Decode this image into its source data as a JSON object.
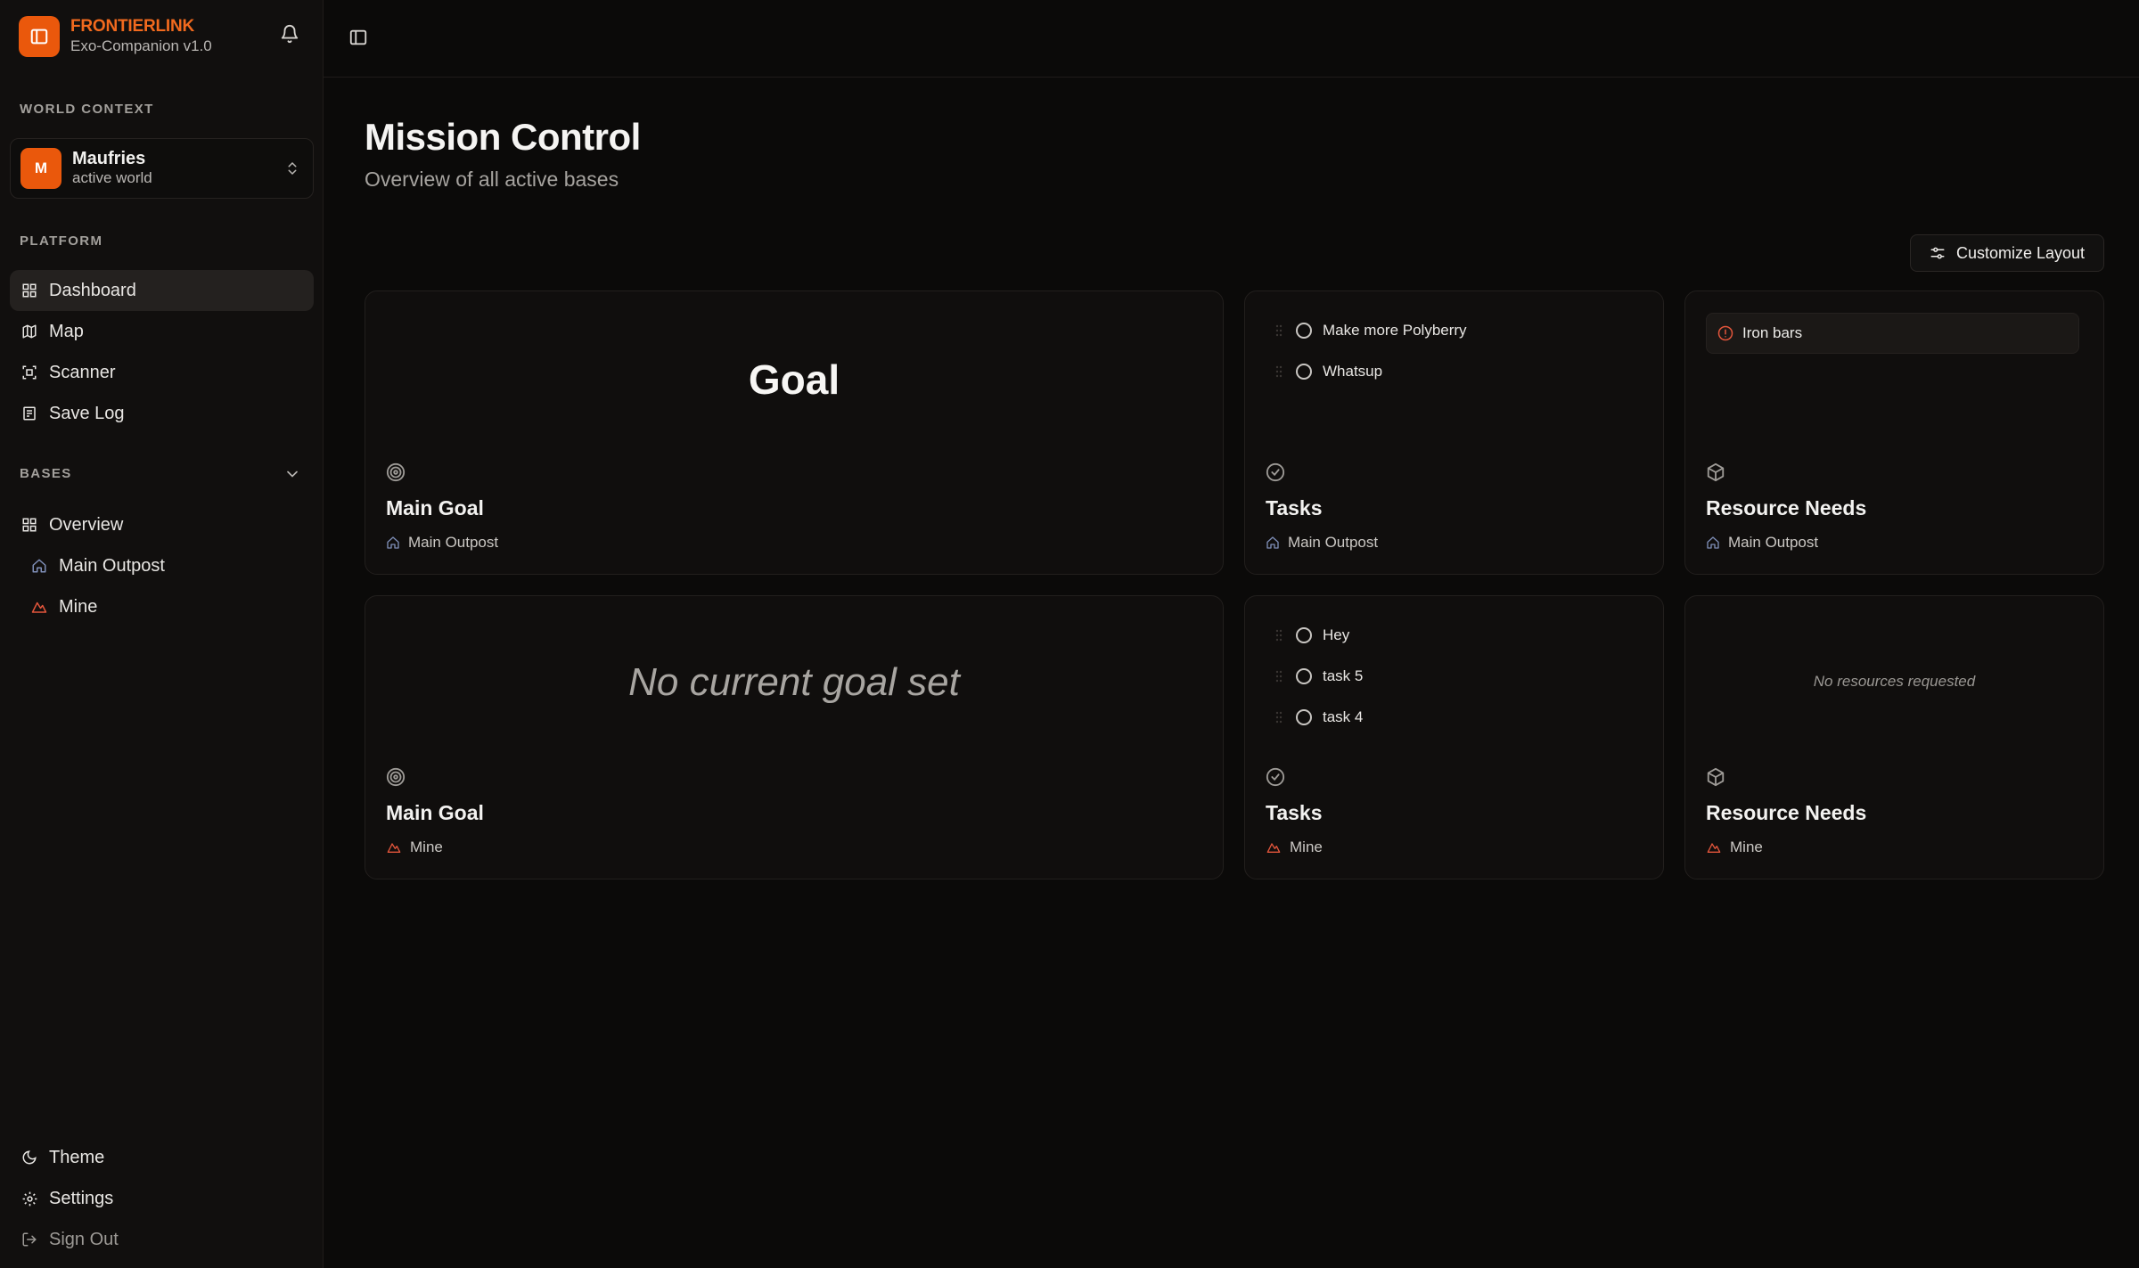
{
  "brand": {
    "name": "FRONTIERLINK",
    "version": "Exo-Companion v1.0"
  },
  "sidebar": {
    "world_context_label": "WORLD CONTEXT",
    "world": {
      "initial": "M",
      "name": "Maufries",
      "status": "active world"
    },
    "platform_label": "PLATFORM",
    "platform_items": [
      {
        "label": "Dashboard",
        "icon": "dashboard-grid-icon",
        "active": true
      },
      {
        "label": "Map",
        "icon": "map-icon"
      },
      {
        "label": "Scanner",
        "icon": "scanner-icon"
      },
      {
        "label": "Save Log",
        "icon": "save-log-icon"
      }
    ],
    "bases_label": "BASES",
    "bases_items": [
      {
        "label": "Overview",
        "icon": "overview-grid-icon"
      },
      {
        "label": "Main Outpost",
        "icon": "home-icon"
      },
      {
        "label": "Mine",
        "icon": "mine-icon"
      }
    ],
    "footer_items": [
      {
        "label": "Theme",
        "icon": "moon-icon"
      },
      {
        "label": "Settings",
        "icon": "gear-icon"
      },
      {
        "label": "Sign Out",
        "icon": "sign-out-icon"
      }
    ]
  },
  "main": {
    "title": "Mission Control",
    "subtitle": "Overview of all active bases",
    "customize_label": "Customize Layout"
  },
  "cards": {
    "outpost_goal": {
      "goal": "Goal",
      "title": "Main Goal",
      "base": "Main Outpost"
    },
    "outpost_tasks": {
      "tasks": [
        "Make more Polyberry",
        "Whatsup"
      ],
      "title": "Tasks",
      "base": "Main Outpost"
    },
    "outpost_resources": {
      "items": [
        "Iron bars"
      ],
      "title": "Resource Needs",
      "base": "Main Outpost"
    },
    "mine_goal": {
      "goal": "No current goal set",
      "title": "Main Goal",
      "base": "Mine"
    },
    "mine_tasks": {
      "tasks": [
        "Hey",
        "task 5",
        "task 4"
      ],
      "title": "Tasks",
      "base": "Mine"
    },
    "mine_resources": {
      "empty": "No resources requested",
      "title": "Resource Needs",
      "base": "Mine"
    }
  },
  "colors": {
    "accent": "#ea580c",
    "background": "#0b0a09",
    "card": "#100e0d"
  }
}
